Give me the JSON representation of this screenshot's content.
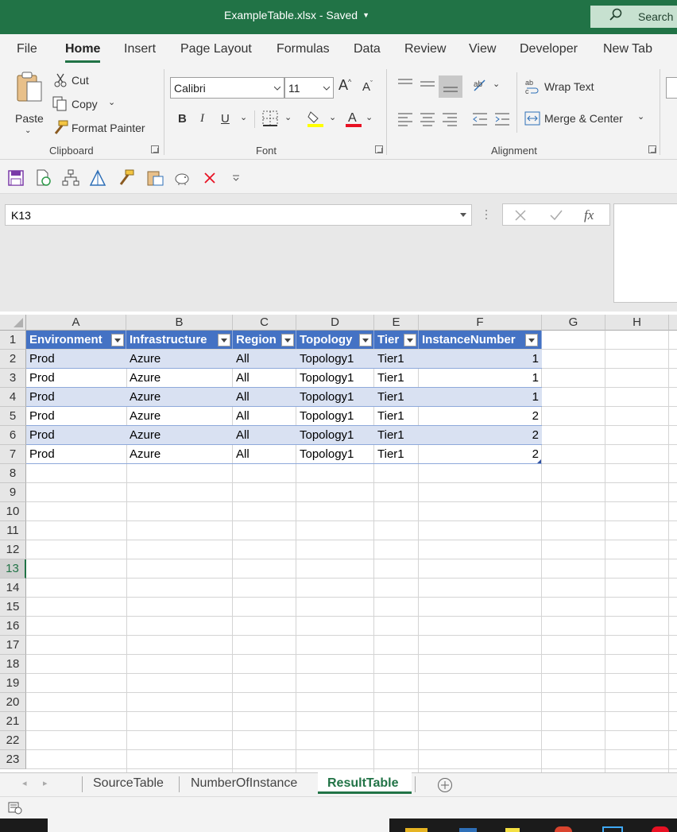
{
  "window": {
    "title": "ExampleTable.xlsx  -  Saved",
    "search_label": "Search"
  },
  "tabs": [
    "File",
    "Home",
    "Insert",
    "Page Layout",
    "Formulas",
    "Data",
    "Review",
    "View",
    "Developer",
    "New Tab"
  ],
  "active_tab": "Home",
  "ribbon": {
    "clipboard": {
      "paste": "Paste",
      "cut": "Cut",
      "copy": "Copy",
      "format_painter": "Format Painter",
      "group": "Clipboard"
    },
    "font": {
      "name": "Calibri",
      "size": "11",
      "bold": "B",
      "italic": "I",
      "underline": "U",
      "group": "Font"
    },
    "alignment": {
      "wrap": "Wrap Text",
      "merge": "Merge & Center",
      "group": "Alignment"
    }
  },
  "formula_bar": {
    "name_box": "K13",
    "fx": "fx"
  },
  "columns": [
    "A",
    "B",
    "C",
    "D",
    "E",
    "F",
    "G",
    "H"
  ],
  "rows": [
    "1",
    "2",
    "3",
    "4",
    "5",
    "6",
    "7",
    "8",
    "9",
    "10",
    "11",
    "12",
    "13",
    "14",
    "15",
    "16",
    "17",
    "18",
    "19",
    "20",
    "21",
    "22",
    "23"
  ],
  "selected_row": "13",
  "table": {
    "headers": [
      "Environment",
      "Infrastructure",
      "Region",
      "Topology",
      "Tier",
      "InstanceNumber"
    ],
    "rows": [
      [
        "Prod",
        "Azure",
        "All",
        "Topology1",
        "Tier1",
        "1"
      ],
      [
        "Prod",
        "Azure",
        "All",
        "Topology1",
        "Tier1",
        "1"
      ],
      [
        "Prod",
        "Azure",
        "All",
        "Topology1",
        "Tier1",
        "1"
      ],
      [
        "Prod",
        "Azure",
        "All",
        "Topology1",
        "Tier1",
        "2"
      ],
      [
        "Prod",
        "Azure",
        "All",
        "Topology1",
        "Tier1",
        "2"
      ],
      [
        "Prod",
        "Azure",
        "All",
        "Topology1",
        "Tier1",
        "2"
      ]
    ]
  },
  "sheets": [
    "SourceTable",
    "NumberOfInstance",
    "ResultTable"
  ],
  "active_sheet": "ResultTable",
  "colors": {
    "excel_green": "#217346",
    "table_header": "#4472c4",
    "table_band": "#d9e1f2"
  }
}
